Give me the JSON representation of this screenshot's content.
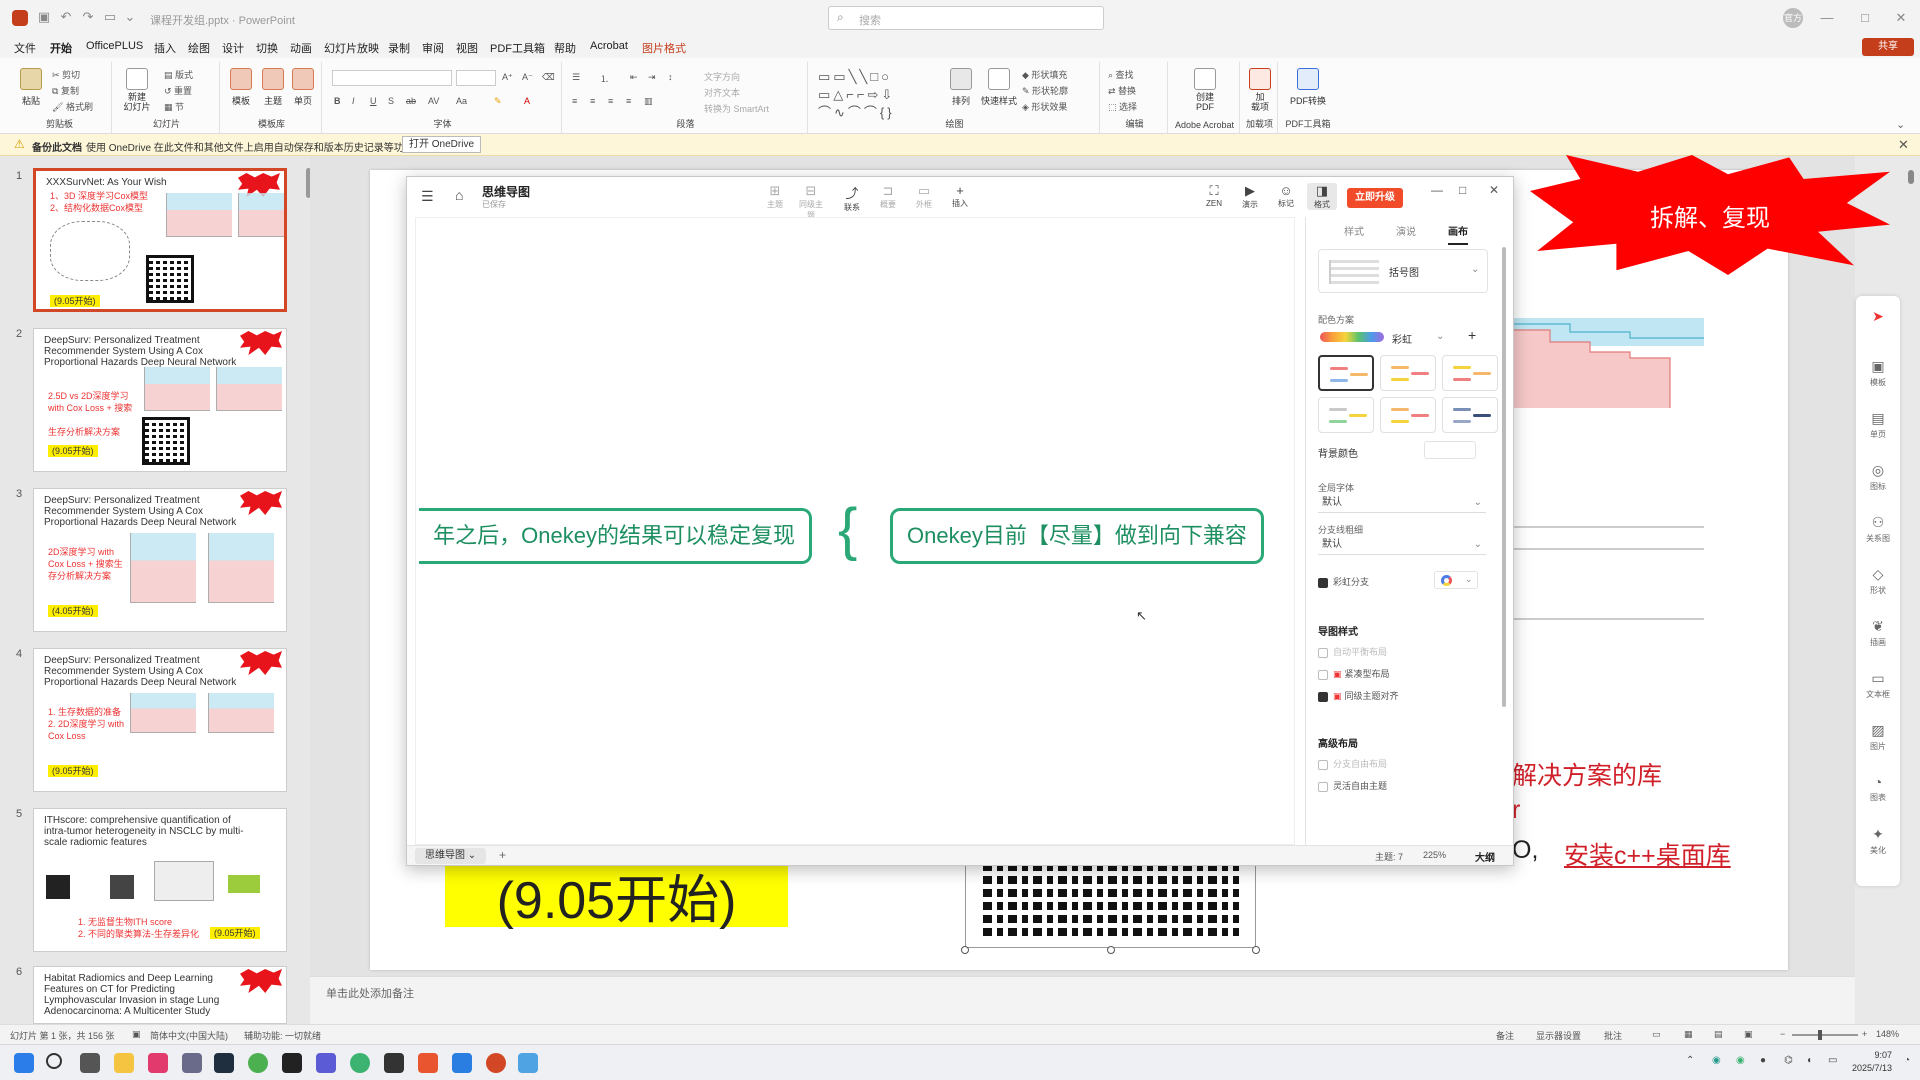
{
  "titlebar": {
    "doc_title": "课程开发组.pptx  ·  PowerPoint",
    "search_placeholder": "搜索",
    "avatar": "官方",
    "min": "—",
    "max": "□",
    "close": "✕"
  },
  "menu": {
    "items": [
      "文件",
      "开始",
      "OfficePLUS",
      "插入",
      "绘图",
      "设计",
      "切换",
      "动画",
      "幻灯片放映",
      "录制",
      "审阅",
      "视图",
      "PDF工具箱",
      "帮助",
      "Acrobat",
      "图片格式"
    ],
    "share": "共享"
  },
  "ribbon": {
    "groups": {
      "clipboard": "剪贴板",
      "slides": "幻灯片",
      "templates": "模板库",
      "font": "字体",
      "paragraph": "段落",
      "drawing": "绘图",
      "editing": "编辑",
      "acrobat": "Adobe Acrobat",
      "addins": "加载项",
      "pdf": "PDF工具箱"
    },
    "paste": "粘贴",
    "cut": "剪切",
    "copy": "复制",
    "format_painter": "格式刷",
    "new_slide": "新建\n幻灯片",
    "layout": "版式",
    "reset": "重置",
    "section": "节",
    "template": "模板",
    "theme": "主题",
    "single": "单页",
    "text_direction": "文字方向",
    "align_text": "对齐文本",
    "smartart": "转换为 SmartArt",
    "arrange": "排列",
    "quick_styles": "快速样式",
    "shape_fill": "形状填充",
    "shape_outline": "形状轮廓",
    "shape_effects": "形状效果",
    "find": "查找",
    "replace": "替换",
    "select": "选择",
    "create_pdf": "创建\nPDF",
    "addin": "加\n载项",
    "pdf_convert": "PDF转换"
  },
  "notification": {
    "title": "备份此文档",
    "text": "使用 OneDrive 在此文件和其他文件上启用自动保存和版本历史记录等功能。",
    "button": "打开 OneDrive"
  },
  "thumbnails": [
    {
      "num": "1",
      "title": "XXXSurvNet: As Your Wish",
      "lines": [
        "1、3D 深度学习Cox模型",
        "2、结构化数据Cox模型"
      ],
      "tag": "(9.05开始)"
    },
    {
      "num": "2",
      "title": "DeepSurv: Personalized Treatment Recommender System Using A Cox Proportional Hazards Deep Neural Network",
      "lines": [
        "2.5D vs 2D深度学习",
        "with Cox Loss + 搜索",
        "",
        "生存分析解决方案"
      ],
      "tag": "(9.05开始)"
    },
    {
      "num": "3",
      "title": "DeepSurv: Personalized Treatment Recommender System Using A Cox Proportional Hazards Deep Neural Network",
      "lines": [
        "2D深度学习 with",
        "Cox Loss + 搜索生",
        "存分析解决方案"
      ],
      "tag": "(4.05开始)"
    },
    {
      "num": "4",
      "title": "DeepSurv: Personalized Treatment Recommender System Using A Cox Proportional Hazards Deep Neural Network",
      "lines": [
        "1. 生存数据的准备",
        "2. 2D深度学习 with",
        "Cox Loss"
      ],
      "tag": "(9.05开始)"
    },
    {
      "num": "5",
      "title": "ITHscore: comprehensive quantification of intra-tumor heterogeneity in NSCLC by multi-scale radiomic features",
      "lines": [
        "1. 无监督生物ITH score",
        "2. 不同的聚类算法-生存差异化"
      ],
      "tag": "(9.05开始)"
    },
    {
      "num": "6",
      "title": "Habitat Radiomics and Deep Learning Features on CT for Predicting Lymphovascular Invasion in stage Lung Adenocarcinoma: A Multicenter Study",
      "lines": [],
      "tag": ""
    }
  ],
  "slide": {
    "burst_text": "拆解、复现",
    "yellow_text": "(9.05开始)",
    "red_line1": "解决方案的库",
    "red_line2": "r",
    "red_line3_prefix": "O,",
    "red_line3": "安装c++桌面库",
    "notes_placeholder": "单击此处添加备注"
  },
  "right_bar": [
    "模板",
    "单页",
    "图标",
    "关系图",
    "形状",
    "插画",
    "文本框",
    "图片",
    "图表",
    "美化"
  ],
  "mindmap": {
    "title": "思维导图",
    "subtitle": "已保存",
    "tools": [
      {
        "label": "主题",
        "icon": "⊞",
        "on": false
      },
      {
        "label": "同级主题",
        "icon": "⊟",
        "on": false
      },
      {
        "label": "联系",
        "icon": "⤴",
        "on": true
      },
      {
        "label": "概要",
        "icon": "⊐",
        "on": false
      },
      {
        "label": "外框",
        "icon": "▭",
        "on": false
      },
      {
        "label": "插入",
        "icon": "+",
        "on": true
      }
    ],
    "right_tools": [
      {
        "label": "ZEN",
        "icon": "⛶"
      },
      {
        "label": "演示",
        "icon": "▶"
      },
      {
        "label": "标记",
        "icon": "☺"
      },
      {
        "label": "格式",
        "icon": "◨"
      }
    ],
    "upgrade": "立即升级",
    "node_left": "年之后，Onekey的结果可以稳定复现",
    "node_right": "Onekey目前【尽量】做到向下兼容",
    "brace": "{",
    "footer": {
      "tab": "思维导图",
      "topics": "主题: 7",
      "zoom": "225%",
      "outline": "大纲"
    },
    "panel": {
      "tabs": [
        "样式",
        "演说",
        "画布"
      ],
      "structure": "括号图",
      "color_scheme_label": "配色方案",
      "color_scheme": "彩虹",
      "bg_color_label": "背景颜色",
      "font_label": "全局字体",
      "font_value": "默认",
      "branch_label": "分支线粗细",
      "branch_value": "默认",
      "rainbow_branch": "彩虹分支",
      "map_style_label": "导图样式",
      "opts": [
        {
          "label": "自动平衡布局",
          "state": "off"
        },
        {
          "label": "紧凑型布局",
          "state": "none"
        },
        {
          "label": "同级主题对齐",
          "state": "on"
        }
      ],
      "advanced_label": "高级布局",
      "adv_opts": [
        {
          "label": "分支自由布局",
          "state": "off"
        },
        {
          "label": "灵活自由主题",
          "state": "none"
        }
      ]
    }
  },
  "status": {
    "slide_info": "幻灯片 第 1 张，共 156 张",
    "lang": "简体中文(中国大陆)",
    "accessibility": "辅助功能: 一切就绪",
    "notes": "备注",
    "display": "显示器设置",
    "comments": "批注",
    "zoom": "148%"
  },
  "taskbar": {
    "time": "9:07",
    "date": "2025/7/13"
  },
  "colors": {
    "accent": "#c43e1c",
    "node_green": "#2aa876",
    "burst_red": "#ff0000",
    "highlight_yellow": "#ffff00"
  }
}
